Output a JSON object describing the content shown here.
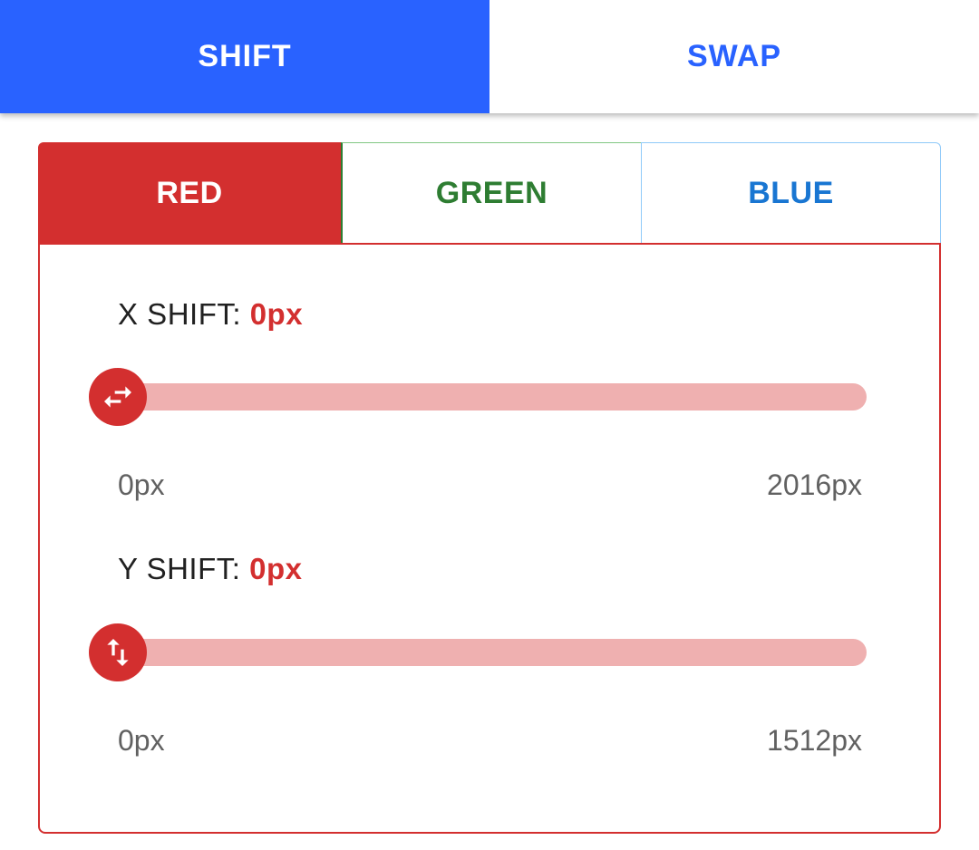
{
  "top_tabs": {
    "shift": "SHIFT",
    "swap": "SWAP",
    "active": "shift"
  },
  "channel_tabs": {
    "red": "RED",
    "green": "GREEN",
    "blue": "BLUE",
    "active": "red"
  },
  "x_shift": {
    "label": "X SHIFT:",
    "value_text": "0px",
    "min_label": "0px",
    "max_label": "2016px",
    "value": 0,
    "min": 0,
    "max": 2016,
    "icon": "swap-horizontal-icon"
  },
  "y_shift": {
    "label": "Y SHIFT:",
    "value_text": "0px",
    "min_label": "0px",
    "max_label": "1512px",
    "value": 0,
    "min": 0,
    "max": 1512,
    "icon": "swap-vertical-icon"
  },
  "colors": {
    "primary_blue": "#2962ff",
    "red": "#d32f2f",
    "red_track": "#efb0b0",
    "green": "#2e7d32",
    "blue": "#1976d2"
  }
}
